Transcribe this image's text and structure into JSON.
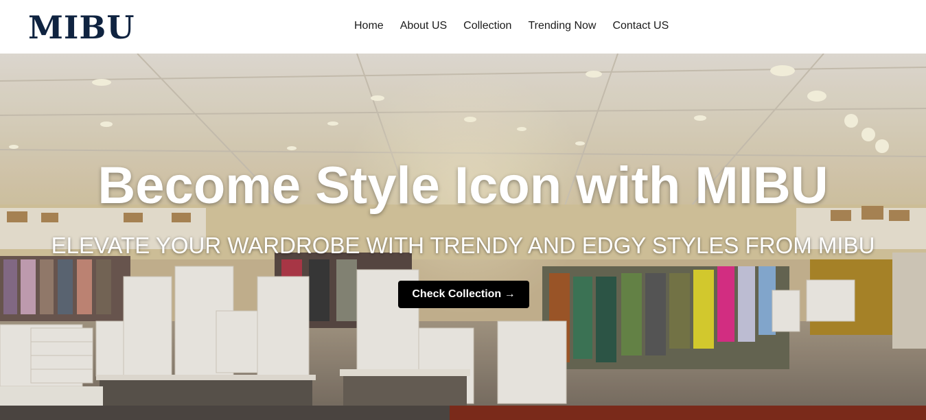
{
  "brand": {
    "logo": "MIBU",
    "color": "#0f2340"
  },
  "nav": {
    "items": [
      {
        "label": "Home"
      },
      {
        "label": "About US"
      },
      {
        "label": "Collection"
      },
      {
        "label": "Trending Now"
      },
      {
        "label": "Contact US"
      }
    ]
  },
  "hero": {
    "title": "Become Style Icon with MIBU",
    "subtitle": "ELEVATE YOUR WARDROBE WITH TRENDY AND EDGY STYLES FROM MIBU",
    "cta_label": "Check Collection →",
    "image_subject": "retail clothing store interior with shoe boxes and clothing racks"
  },
  "colors": {
    "cta_bg": "#000000",
    "accent_strip": "#7a2a1a"
  }
}
